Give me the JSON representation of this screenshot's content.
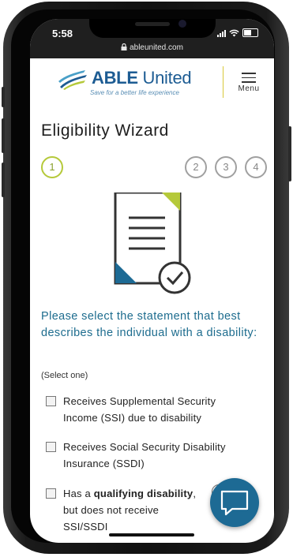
{
  "status_bar": {
    "time": "5:58",
    "url": "ableunited.com"
  },
  "header": {
    "brand_strong": "ABLE",
    "brand_light": " United",
    "tagline": "Save for a better life experience",
    "menu_label": "Menu"
  },
  "wizard": {
    "title": "Eligibility Wizard",
    "steps": [
      "1",
      "2",
      "3",
      "4"
    ],
    "active_step": 1
  },
  "question": {
    "prompt": "Please select the statement that best describes the individual with a disability:",
    "hint": "(Select one)",
    "options": [
      {
        "line1": "Receives Supplemental Security",
        "line2": "Income (SSI) due to disability"
      },
      {
        "line1": "Receives Social Security Disability",
        "line2": "Insurance (SSDI)"
      },
      {
        "line1_pre": "Has a ",
        "line1_strong": "qualifying disability",
        "line1_post": ",",
        "line2": "but does not receive",
        "line3": "SSI/SSDI"
      }
    ]
  },
  "colors": {
    "brand_blue": "#1d5c93",
    "accent_green": "#b5c93a",
    "prompt_teal": "#1d6c8e",
    "chat_blue": "#1d6a94"
  },
  "icons": [
    "lock-icon",
    "signal-icon",
    "wifi-icon",
    "battery-icon",
    "menu-icon",
    "document-check-icon",
    "info-icon",
    "chat-icon"
  ]
}
